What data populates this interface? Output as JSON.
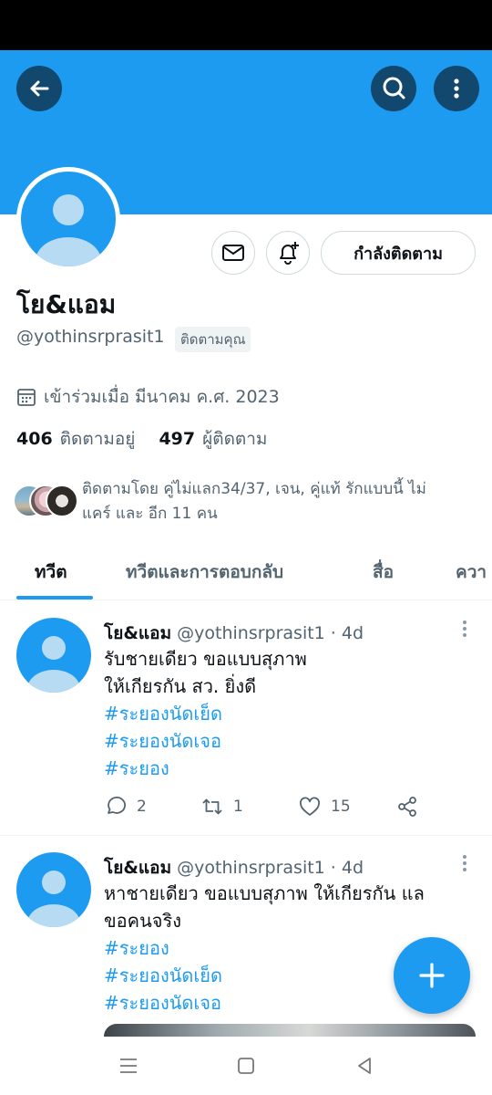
{
  "header": {
    "back_icon": "arrow-left-icon",
    "search_icon": "search-icon",
    "more_icon": "more-vertical-icon",
    "banner_color": "#1d9bf0"
  },
  "profile": {
    "display_name": "โย&แอม",
    "handle": "@yothinsrprasit1",
    "follows_you": "ติดตามคุณ",
    "joined": "เข้าร่วมเมื่อ มีนาคม ค.ศ. 2023",
    "following_count": "406",
    "following_label": "ติดตามอยู่",
    "followers_count": "497",
    "followers_label": "ผู้ติดตาม",
    "followed_by_line1": "ติดตามโดย คู่ไม่แลก34/37, เจน, คู่แท้ รักแบบนี้ ไม่",
    "followed_by_line2": "แคร์ และ อีก 11 คน"
  },
  "buttons": {
    "following_label": "กำลังติดตาม",
    "message_icon": "mail-icon",
    "notify_icon": "bell-plus-icon"
  },
  "tabs": [
    {
      "label": "ทวีต",
      "active": true
    },
    {
      "label": "ทวีตและการตอบกลับ",
      "active": false
    },
    {
      "label": "สื่อ",
      "active": false
    },
    {
      "label": "ควา",
      "active": false
    }
  ],
  "tweets": [
    {
      "name": "โย&แอม",
      "meta": " @yothinsrprasit1 · 4d",
      "lines": [
        "รับชายเดียว ขอแบบสุภาพ",
        "ให้เกียรกัน สว. ยิ่งดี"
      ],
      "tags": [
        "#ระยองนัดเย็ด",
        "#ระยองนัดเจอ",
        "#ระยอง"
      ],
      "replies": "2",
      "retweets": "1",
      "likes": "15"
    },
    {
      "name": "โย&แอม",
      "meta": " @yothinsrprasit1 · 4d",
      "lines": [
        "หาชายเดียว ขอแบบสุภาพ ให้เกียรกัน แล",
        "ขอคนจริง"
      ],
      "tags": [
        "#ระยอง",
        "#ระยองนัดเย็ด",
        "#ระยองนัดเจอ"
      ]
    }
  ],
  "fab_icon": "plus-icon",
  "navbar": {
    "menu_icon": "menu-icon",
    "home_icon": "square-icon",
    "back_icon": "triangle-back-icon"
  }
}
